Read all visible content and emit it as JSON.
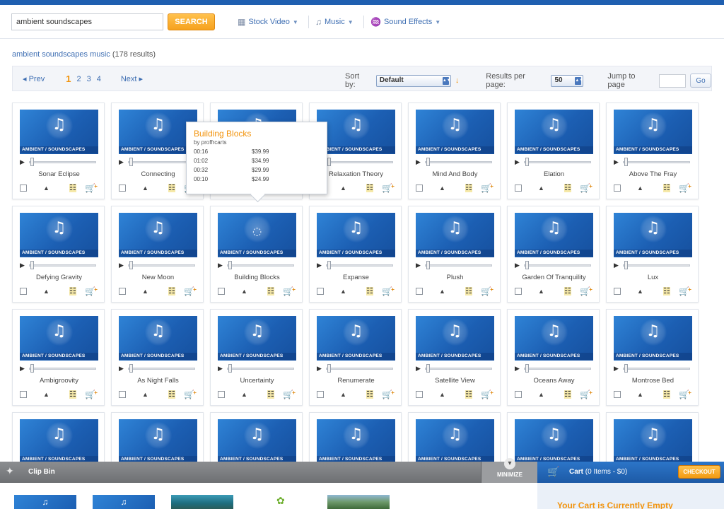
{
  "search": {
    "value": "ambient soundscapes",
    "button_label": "SEARCH"
  },
  "categories": [
    {
      "label": "Stock Video",
      "icon": "film-icon"
    },
    {
      "label": "Music",
      "icon": "music-note-icon"
    },
    {
      "label": "Sound Effects",
      "icon": "sound-wave-icon"
    }
  ],
  "summary": {
    "query_link": "ambient soundscapes music",
    "count": "(178 results)"
  },
  "pager": {
    "prev_label": "◂ Prev",
    "pages": [
      "1",
      "2",
      "3",
      "4"
    ],
    "current_page": "1",
    "next_label": "Next ▸"
  },
  "sort": {
    "label": "Sort by:",
    "value": "Default",
    "results_label": "Results per page:",
    "results_value": "50",
    "jump_label": "Jump to page",
    "go_label": "Go"
  },
  "genre_label": "AMBIENT / SOUNDSCAPES",
  "clips": [
    {
      "title": "Sonar Eclipse"
    },
    {
      "title": "Connecting"
    },
    {
      "title": ""
    },
    {
      "title": "Relaxation Theory"
    },
    {
      "title": "Mind And Body"
    },
    {
      "title": "Elation"
    },
    {
      "title": "Above The Fray"
    },
    {
      "title": "Defying Gravity"
    },
    {
      "title": "New Moon"
    },
    {
      "title": "Building Blocks",
      "loading": true
    },
    {
      "title": "Expanse"
    },
    {
      "title": "Plush"
    },
    {
      "title": "Garden Of Tranquility"
    },
    {
      "title": "Lux"
    },
    {
      "title": "Ambigroovity"
    },
    {
      "title": "As Night Falls"
    },
    {
      "title": "Uncertainty"
    },
    {
      "title": "Renumerate"
    },
    {
      "title": "Satellite View"
    },
    {
      "title": "Oceans Away"
    },
    {
      "title": "Montrose Bed"
    },
    {
      "title": ""
    },
    {
      "title": ""
    },
    {
      "title": ""
    },
    {
      "title": ""
    },
    {
      "title": ""
    },
    {
      "title": ""
    },
    {
      "title": ""
    }
  ],
  "popup": {
    "title": "Building Blocks",
    "by": "by proffrcarts",
    "rows": [
      {
        "duration": "00:16",
        "price": "$39.99"
      },
      {
        "duration": "01:02",
        "price": "$34.99"
      },
      {
        "duration": "00:32",
        "price": "$29.99"
      },
      {
        "duration": "00:10",
        "price": "$24.99"
      }
    ]
  },
  "clip_bin": {
    "label": "Clip Bin",
    "minimize_label": "MINIMIZE"
  },
  "cart": {
    "label": "Cart",
    "count": "(0 Items - $0)",
    "checkout_label": "CHECKOUT",
    "empty_message": "Your Cart is Currently Empty"
  },
  "colors": {
    "accent_orange": "#f2930c",
    "brand_blue": "#1f5fb0",
    "link_blue": "#3f6fb3"
  }
}
